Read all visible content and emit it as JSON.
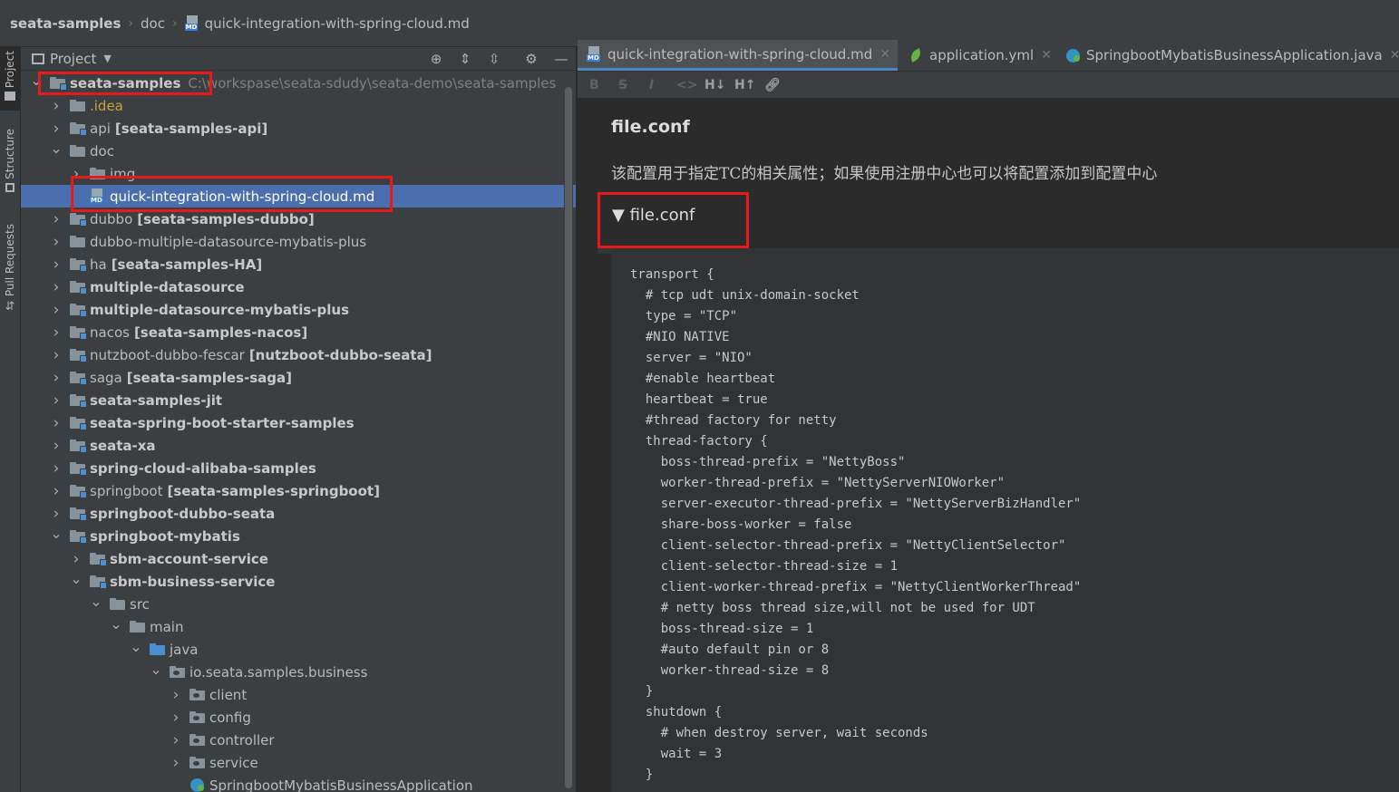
{
  "breadcrumb": [
    "seata-samples",
    "doc",
    "quick-integration-with-spring-cloud.md"
  ],
  "tool_strip": {
    "project_label": "Project",
    "structure_label": "Structure",
    "pull_requests_label": "Pull Requests"
  },
  "project_panel": {
    "title": "Project",
    "tree": [
      {
        "name": "seata-samples",
        "bold": true,
        "path": "C:\\workspase\\seata-sdudy\\seata-demo\\seata-samples",
        "indent": 0,
        "chevron": "down",
        "icon": "folder-module"
      },
      {
        "name": ".idea",
        "indent": 1,
        "chevron": "right",
        "icon": "folder"
      },
      {
        "name": "api",
        "module": "[seata-samples-api]",
        "indent": 1,
        "chevron": "right",
        "icon": "folder-module"
      },
      {
        "name": "doc",
        "indent": 1,
        "chevron": "down",
        "icon": "folder"
      },
      {
        "name": "img",
        "indent": 2,
        "chevron": "right",
        "icon": "folder"
      },
      {
        "name": "quick-integration-with-spring-cloud.md",
        "indent": 2,
        "chevron": "",
        "icon": "md-file",
        "selected": true
      },
      {
        "name": "dubbo",
        "module": "[seata-samples-dubbo]",
        "indent": 1,
        "chevron": "right",
        "icon": "folder-module"
      },
      {
        "name": "dubbo-multiple-datasource-mybatis-plus",
        "indent": 1,
        "chevron": "right",
        "icon": "folder"
      },
      {
        "name": "ha",
        "module": "[seata-samples-HA]",
        "indent": 1,
        "chevron": "right",
        "icon": "folder-module"
      },
      {
        "name": "multiple-datasource",
        "bold": true,
        "indent": 1,
        "chevron": "right",
        "icon": "folder-module"
      },
      {
        "name": "multiple-datasource-mybatis-plus",
        "bold": true,
        "indent": 1,
        "chevron": "right",
        "icon": "folder-module"
      },
      {
        "name": "nacos",
        "module": "[seata-samples-nacos]",
        "indent": 1,
        "chevron": "right",
        "icon": "folder-module"
      },
      {
        "name": "nutzboot-dubbo-fescar",
        "module": "[nutzboot-dubbo-seata]",
        "indent": 1,
        "chevron": "right",
        "icon": "folder-module"
      },
      {
        "name": "saga",
        "module": "[seata-samples-saga]",
        "indent": 1,
        "chevron": "right",
        "icon": "folder-module"
      },
      {
        "name": "seata-samples-jit",
        "bold": true,
        "indent": 1,
        "chevron": "right",
        "icon": "folder-module"
      },
      {
        "name": "seata-spring-boot-starter-samples",
        "bold": true,
        "indent": 1,
        "chevron": "right",
        "icon": "folder-module"
      },
      {
        "name": "seata-xa",
        "bold": true,
        "indent": 1,
        "chevron": "right",
        "icon": "folder-module"
      },
      {
        "name": "spring-cloud-alibaba-samples",
        "bold": true,
        "indent": 1,
        "chevron": "right",
        "icon": "folder-module"
      },
      {
        "name": "springboot",
        "module": "[seata-samples-springboot]",
        "indent": 1,
        "chevron": "right",
        "icon": "folder-module"
      },
      {
        "name": "springboot-dubbo-seata",
        "bold": true,
        "indent": 1,
        "chevron": "right",
        "icon": "folder-module"
      },
      {
        "name": "springboot-mybatis",
        "bold": true,
        "indent": 1,
        "chevron": "down",
        "icon": "folder-module"
      },
      {
        "name": "sbm-account-service",
        "bold": true,
        "indent": 2,
        "chevron": "right",
        "icon": "folder-module"
      },
      {
        "name": "sbm-business-service",
        "bold": true,
        "indent": 2,
        "chevron": "down",
        "icon": "folder-module"
      },
      {
        "name": "src",
        "indent": 3,
        "chevron": "down",
        "icon": "folder"
      },
      {
        "name": "main",
        "indent": 4,
        "chevron": "down",
        "icon": "folder"
      },
      {
        "name": "java",
        "indent": 5,
        "chevron": "down",
        "icon": "folder-blue"
      },
      {
        "name": "io.seata.samples.business",
        "indent": 6,
        "chevron": "down",
        "icon": "package"
      },
      {
        "name": "client",
        "indent": 7,
        "chevron": "right",
        "icon": "package"
      },
      {
        "name": "config",
        "indent": 7,
        "chevron": "right",
        "icon": "package"
      },
      {
        "name": "controller",
        "indent": 7,
        "chevron": "right",
        "icon": "package"
      },
      {
        "name": "service",
        "indent": 7,
        "chevron": "right",
        "icon": "package"
      },
      {
        "name": "SpringbootMybatisBusinessApplication",
        "indent": 7,
        "chevron": "",
        "icon": "java-spring"
      }
    ]
  },
  "editor": {
    "tabs": [
      {
        "label": "quick-integration-with-spring-cloud.md",
        "icon": "md-file",
        "active": true
      },
      {
        "label": "application.yml",
        "icon": "yml-leaf"
      },
      {
        "label": "SpringbootMybatisBusinessApplication.java",
        "icon": "java-spring"
      }
    ],
    "toolbar": [
      "B",
      "S",
      "I",
      "<>",
      "H↓",
      "H↑",
      "link"
    ],
    "preview": {
      "heading": "file.conf",
      "description": "该配置用于指定TC的相关属性；如果使用注册中心也可以将配置添加到配置中心",
      "summary": "▼ file.conf",
      "code": [
        "transport {",
        "  # tcp udt unix-domain-socket",
        "  type = \"TCP\"",
        "  #NIO NATIVE",
        "  server = \"NIO\"",
        "  #enable heartbeat",
        "  heartbeat = true",
        "  #thread factory for netty",
        "  thread-factory {",
        "    boss-thread-prefix = \"NettyBoss\"",
        "    worker-thread-prefix = \"NettyServerNIOWorker\"",
        "    server-executor-thread-prefix = \"NettyServerBizHandler\"",
        "    share-boss-worker = false",
        "    client-selector-thread-prefix = \"NettyClientSelector\"",
        "    client-selector-thread-size = 1",
        "    client-worker-thread-prefix = \"NettyClientWorkerThread\"",
        "    # netty boss thread size,will not be used for UDT",
        "    boss-thread-size = 1",
        "    #auto default pin or 8",
        "    worker-thread-size = 8",
        "  }",
        "  shutdown {",
        "    # when destroy server, wait seconds",
        "    wait = 3",
        "  }"
      ]
    }
  },
  "colors": {
    "selection": "#4b6eaf",
    "highlight": "#e8191b",
    "accent": "#4a88c7"
  }
}
